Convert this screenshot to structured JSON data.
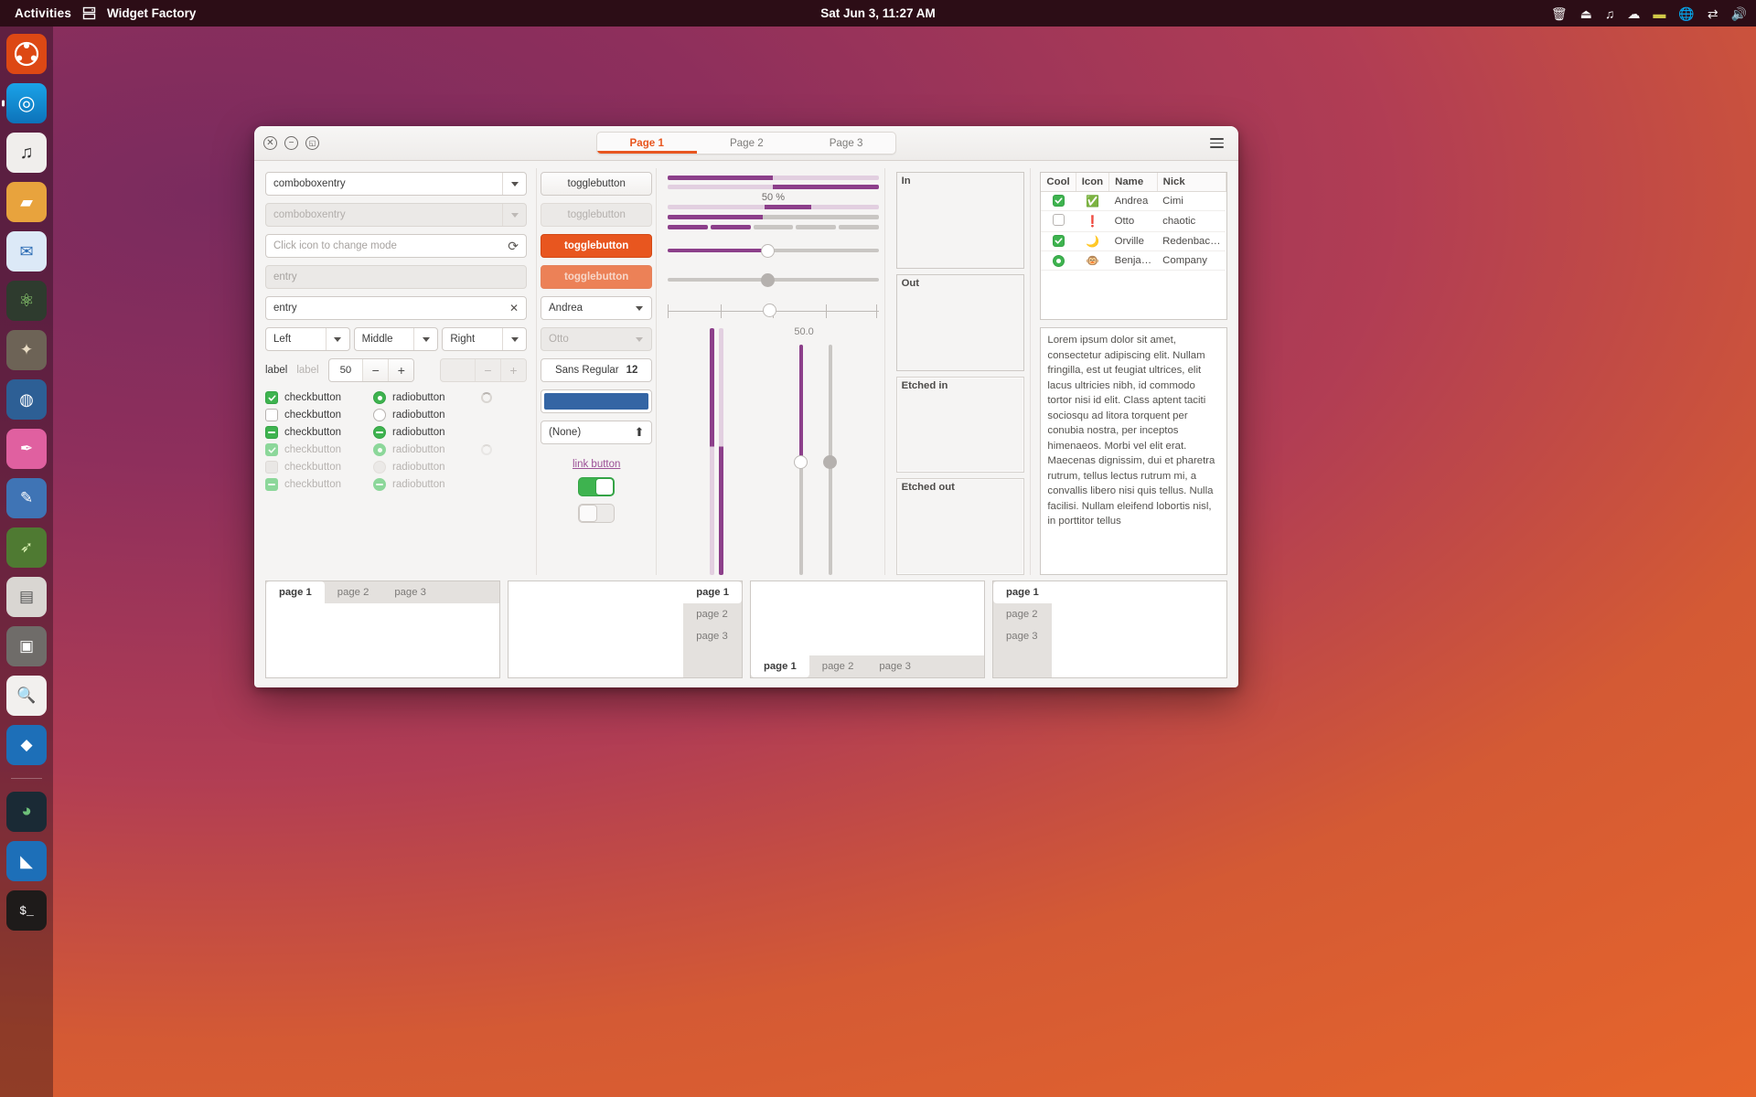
{
  "topbar": {
    "activities": "Activities",
    "app_name": "Widget Factory",
    "app_icon": "window-icon",
    "clock": "Sat Jun  3, 11:27 AM",
    "indicators": [
      "trash-icon",
      "eject-icon",
      "music-note-icon",
      "weather-cloud-icon",
      "battery-icon",
      "network-globe-icon",
      "bluetooth-icon",
      "volume-icon"
    ]
  },
  "dock": {
    "items": [
      {
        "name": "ubuntu-logo",
        "glyph": "◉",
        "color": "#dd4814",
        "running": false
      },
      {
        "name": "firefox",
        "glyph": "◎",
        "color": "#e8f4ff",
        "running": true
      },
      {
        "name": "rhythmbox",
        "glyph": "♫",
        "color": "#f0f0f0",
        "running": false
      },
      {
        "name": "files",
        "glyph": "🗀",
        "color": "#f5a623",
        "running": false
      },
      {
        "name": "thunderbird",
        "glyph": "✉",
        "color": "#dce9f7",
        "running": false
      },
      {
        "name": "atom",
        "glyph": "⚛",
        "color": "#9ae27a",
        "running": false
      },
      {
        "name": "gimp",
        "glyph": "✦",
        "color": "#d9cbb0",
        "running": false
      },
      {
        "name": "blender",
        "glyph": "◍",
        "color": "#4a90d9",
        "running": false
      },
      {
        "name": "color-picker",
        "glyph": "✒",
        "color": "#e060a0",
        "running": false
      },
      {
        "name": "inkscape",
        "glyph": "✎",
        "color": "#4a7fc1",
        "running": false
      },
      {
        "name": "eyedropper",
        "glyph": "➶",
        "color": "#79b84a",
        "running": false
      },
      {
        "name": "text-editor",
        "glyph": "▤",
        "color": "#cfcfcf",
        "running": false
      },
      {
        "name": "system-settings",
        "glyph": "▣",
        "color": "#a0a0a0",
        "running": false
      },
      {
        "name": "software-search",
        "glyph": "🔍",
        "color": "#ffffff",
        "running": false
      },
      {
        "name": "vs-code-blue",
        "glyph": "◆",
        "color": "#2e8fd6",
        "running": false
      },
      {
        "name": "ubuntu-software",
        "glyph": "◕",
        "color": "#5fbf7f",
        "running": false
      },
      {
        "name": "vs-code",
        "glyph": "◣",
        "color": "#2e8fd6",
        "running": false
      },
      {
        "name": "terminal",
        "glyph": "$_",
        "color": "#ffffff",
        "running": false
      }
    ]
  },
  "window": {
    "titlebar": {
      "close": "✕",
      "minimize": "−",
      "maximize": "◱",
      "menu_icon": "hamburger-menu-icon"
    },
    "tabs": [
      {
        "label": "Page 1",
        "active": true
      },
      {
        "label": "Page 2",
        "active": false
      },
      {
        "label": "Page 3",
        "active": false
      }
    ],
    "accent_color": "#e8561f"
  },
  "col1": {
    "comboboxentry": "comboboxentry",
    "comboboxentry_disabled": "comboboxentry",
    "mode_entry_placeholder": "Click icon to change mode",
    "mode_entry_icon": "refresh-icon",
    "entry_disabled_placeholder": "entry",
    "entry_value": "entry",
    "entry_clear_icon": "clear-x-icon",
    "align_left": "Left",
    "align_middle": "Middle",
    "align_right": "Right",
    "label_active": "label",
    "label_disabled": "label",
    "spin_value": "50",
    "spin_minus": "−",
    "spin_plus": "+",
    "spin2_minus": "−",
    "spin2_plus": "+",
    "checkrows": [
      {
        "check_state": "on",
        "check_label": "checkbutton",
        "radio_state": "on",
        "radio_label": "radiobutton",
        "spinner": true,
        "insensitive": false
      },
      {
        "check_state": "off",
        "check_label": "checkbutton",
        "radio_state": "off",
        "radio_label": "radiobutton",
        "spinner": false,
        "insensitive": false
      },
      {
        "check_state": "mixed",
        "check_label": "checkbutton",
        "radio_state": "mixed",
        "radio_label": "radiobutton",
        "spinner": false,
        "insensitive": false
      },
      {
        "check_state": "on",
        "check_label": "checkbutton",
        "radio_state": "on",
        "radio_label": "radiobutton",
        "spinner": true,
        "insensitive": true
      },
      {
        "check_state": "off",
        "check_label": "checkbutton",
        "radio_state": "off",
        "radio_label": "radiobutton",
        "spinner": false,
        "insensitive": true
      },
      {
        "check_state": "mixed",
        "check_label": "checkbutton",
        "radio_state": "mixed",
        "radio_label": "radiobutton",
        "spinner": false,
        "insensitive": true
      }
    ]
  },
  "col2": {
    "toggle1": "togglebutton",
    "toggle2": "togglebutton",
    "toggle3": "togglebutton",
    "toggle4": "togglebutton",
    "combo_name": "Andrea",
    "combo_name_disabled": "Otto",
    "font_name": "Sans Regular",
    "font_size": "12",
    "color_value": "#3465a4",
    "file_label": "(None)",
    "file_icon": "upload-icon",
    "link_label": "link button",
    "switch_on": true,
    "switch_off": false
  },
  "col3": {
    "progress_percent_label": "50 %",
    "vertical_scale_value": "50.0",
    "bars": [
      {
        "name": "progressbar-ltr",
        "fraction": 0.5,
        "direction": "ltr"
      },
      {
        "name": "progressbar-rtl",
        "fraction": 0.5,
        "direction": "rtl"
      },
      {
        "name": "progressbar-centered",
        "fraction": 0.5,
        "direction": "center"
      },
      {
        "name": "levelbar-continuous",
        "fraction": 0.45
      },
      {
        "name": "levelbar-discrete",
        "segments": 5,
        "filled": 2
      }
    ],
    "scales": [
      {
        "name": "scale-horizontal",
        "value": 50,
        "sensitive": true
      },
      {
        "name": "scale-horizontal-insensitive",
        "value": 50,
        "sensitive": false
      },
      {
        "name": "scale-with-marks",
        "value": 50,
        "marks": 5
      }
    ]
  },
  "col4": {
    "frames": [
      {
        "label": "In"
      },
      {
        "label": "Out"
      },
      {
        "label": "Etched in"
      },
      {
        "label": "Etched out"
      }
    ]
  },
  "col5": {
    "tree": {
      "columns": [
        "Cool",
        "Icon",
        "Name",
        "Nick"
      ],
      "rows": [
        {
          "cool": "checked",
          "icon": "check-circle-icon",
          "icon_glyph": "✔",
          "name": "Andrea",
          "nick": "Cimi"
        },
        {
          "cool": "unchecked",
          "icon": "warning-circle-icon",
          "icon_glyph": "!",
          "name": "Otto",
          "nick": "chaotic"
        },
        {
          "cool": "checked",
          "icon": "moon-icon",
          "icon_glyph": "☾",
          "name": "Orville",
          "nick": "Redenbac…"
        },
        {
          "cool": "radio",
          "icon": "monkey-icon",
          "icon_glyph": "🐵",
          "name": "Benja…",
          "nick": "Company"
        }
      ]
    },
    "textview": "Lorem ipsum dolor sit amet, consectetur adipiscing elit. Nullam fringilla, est ut feugiat ultrices, elit lacus ultricies nibh, id commodo tortor nisi id elit. Class aptent taciti sociosqu ad litora torquent per conubia nostra, per inceptos himenaeos. Morbi vel elit erat. Maecenas dignissim, dui et pharetra rutrum, tellus lectus rutrum mi, a convallis libero nisi quis tellus. Nulla facilisi. Nullam eleifend lobortis nisl, in porttitor tellus"
  },
  "notebooks": [
    {
      "name": "notebook-tabs-top",
      "position": "top",
      "tabs": [
        "page 1",
        "page 2",
        "page 3"
      ],
      "active": 0
    },
    {
      "name": "notebook-tabs-right",
      "position": "right",
      "tabs": [
        "page 1",
        "page 2",
        "page 3"
      ],
      "active": 0
    },
    {
      "name": "notebook-tabs-bottom",
      "position": "bottom",
      "tabs": [
        "page 1",
        "page 2",
        "page 3"
      ],
      "active": 0
    },
    {
      "name": "notebook-tabs-left",
      "position": "left",
      "tabs": [
        "page 1",
        "page 2",
        "page 3"
      ],
      "active": 0
    }
  ]
}
